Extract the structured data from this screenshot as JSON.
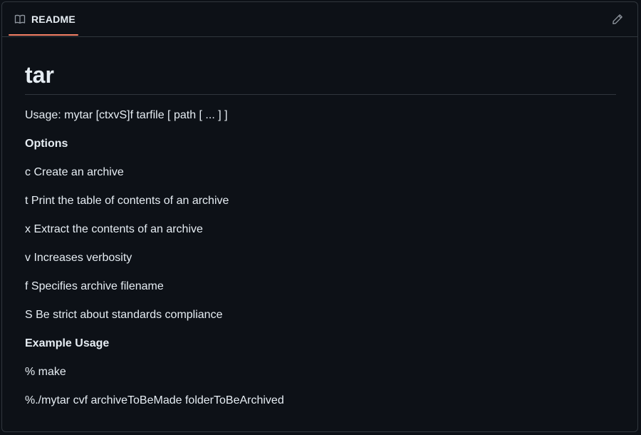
{
  "tab": {
    "label": "README",
    "icon": "book-icon",
    "accent": "#f78166"
  },
  "actions": {
    "edit_icon": "pencil-icon"
  },
  "readme": {
    "title": "tar",
    "usage": "Usage: mytar [ctxvS]f tarfile [ path [ ... ] ]",
    "options_heading": "Options",
    "options": [
      "c Create an archive",
      "t Print the table of contents of an archive",
      "x Extract the contents of an archive",
      "v Increases verbosity",
      "f Specifies archive filename",
      "S Be strict about standards compliance"
    ],
    "example_heading": "Example Usage",
    "examples": [
      "% make",
      "%./mytar cvf archiveToBeMade folderToBeArchived"
    ]
  },
  "colors": {
    "background": "#0d1117",
    "border": "#30363d",
    "text": "#e6edf3",
    "muted": "#9198a1"
  }
}
